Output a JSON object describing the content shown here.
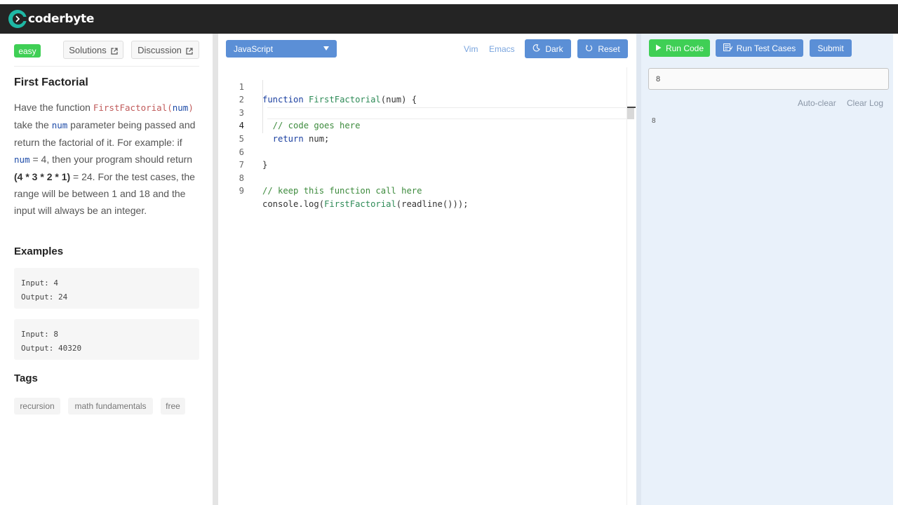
{
  "app": {
    "logo_text": "coderbyte",
    "colors": {
      "topbar": "#242424",
      "accent_blue": "#5b8fd6",
      "accent_green": "#3fcf55",
      "panel_bg": "#e9f1fa"
    }
  },
  "problem": {
    "difficulty": "easy",
    "solutions_label": "Solutions",
    "discussion_label": "Discussion",
    "title": "First Factorial",
    "desc": {
      "p1": "Have the function ",
      "fn_name": "FirstFactorial",
      "paren_open": "(",
      "arg": "num",
      "paren_close": ")",
      "p2": " take the ",
      "arg2": "num",
      "p3": " parameter being passed and return the factorial of it. For example: if ",
      "arg3": "num",
      "p4": " = 4, then your program should return ",
      "bold_expr": "(4 * 3 * 2 * 1)",
      "p5": " = 24. For the test cases, the range will be between 1 and 18 and the input will always be an integer."
    },
    "examples_heading": "Examples",
    "examples": [
      {
        "input": "Input: 4",
        "output": "Output: 24"
      },
      {
        "input": "Input: 8",
        "output": "Output: 40320"
      }
    ],
    "tags_heading": "Tags",
    "tags": [
      "recursion",
      "math fundamentals",
      "free"
    ]
  },
  "editor": {
    "language": "JavaScript",
    "vim_label": "Vim",
    "emacs_label": "Emacs",
    "dark_label": "Dark",
    "reset_label": "Reset",
    "lines": [
      {
        "num": "1",
        "a": "function ",
        "b": "FirstFactorial",
        "c": "(num) {"
      },
      {
        "num": "2"
      },
      {
        "num": "3",
        "comment": "  // code goes here"
      },
      {
        "num": "4",
        "kw": "  return",
        "rest": " num;"
      },
      {
        "num": "5"
      },
      {
        "num": "6",
        "rest": "}"
      },
      {
        "num": "7"
      },
      {
        "num": "8",
        "comment": "// keep this function call here"
      },
      {
        "num": "9",
        "a": "console.log(",
        "b": "FirstFactorial",
        "c": "(readline()));"
      }
    ]
  },
  "runner": {
    "run_code_label": "Run Code",
    "run_tests_label": "Run Test Cases",
    "submit_label": "Submit",
    "input_value": "8",
    "autoclear_label": "Auto-clear",
    "clear_log_label": "Clear Log",
    "log_output": "8"
  }
}
